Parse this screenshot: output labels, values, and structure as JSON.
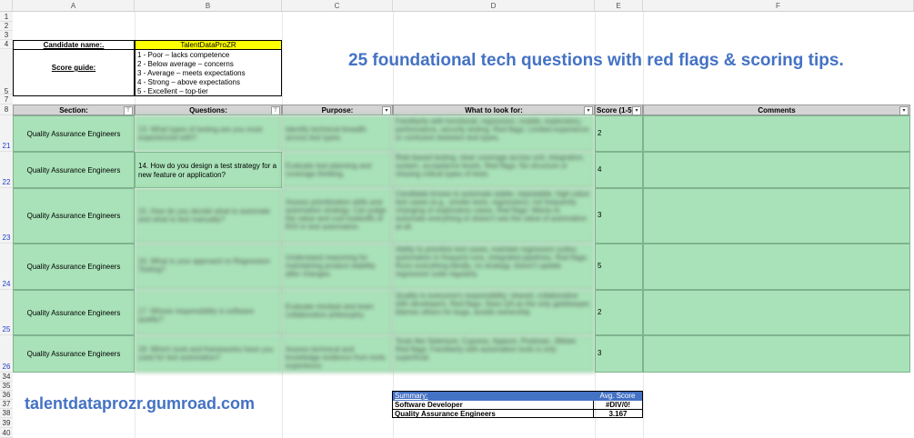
{
  "columns": [
    "A",
    "B",
    "C",
    "D",
    "E",
    "F"
  ],
  "row_numbers": {
    "top": [
      "1",
      "2",
      "3",
      "4",
      "5",
      "7",
      "8"
    ],
    "data": [
      "21",
      "22",
      "23",
      "24",
      "25",
      "26"
    ],
    "bottom": [
      "34",
      "35",
      "36",
      "37",
      "38",
      "39",
      "40"
    ]
  },
  "candidate": {
    "label": "Candidate name:.",
    "value": "TalentDataProZR"
  },
  "score_guide": {
    "label": "Score guide:",
    "items": [
      "1 - Poor – lacks competence",
      "2 - Below average – concerns",
      "3 - Average – meets expectations",
      "4 - Strong – above expectations",
      "5 - Excellent – top-tier"
    ]
  },
  "headline": "25 foundational tech questions with red flags & scoring tips.",
  "table_headers": {
    "section": "Section:",
    "questions": "Questions:",
    "purpose": "Purpose:",
    "what": "What to look for:",
    "score": "Score (1-5):",
    "comments": "Comments"
  },
  "rows": [
    {
      "section": "Quality Assurance Engineers",
      "question": "13. What types of testing are you most experienced with?",
      "purpose": "Identify technical breadth across test types.",
      "what": "Familiarity with functional, regression, mobile, exploratory, performance, security testing. Red flags: Limited experience or confusion between test types.",
      "score": "2"
    },
    {
      "section": "Quality Assurance Engineers",
      "question": "14. How do you design a test strategy for a new feature or application?",
      "purpose": "Evaluate test planning and coverage thinking.",
      "what": "Risk-based testing, clear coverage across unit, integration, system, acceptance levels. Red flags: No structure or missing critical types of tests.",
      "score": "4"
    },
    {
      "section": "Quality Assurance Engineers",
      "question": "15. How do you decide what to automate and what to test manually?",
      "purpose": "Assess prioritization skills and automation strategy. Can judge the value and cost tradeoffs of ROI in test automation.",
      "what": "Candidate knows to automate stable, repeatable, high-value test cases (e.g., smoke tests, regression); not frequently changing or exploratory cases. Red flags: Wants to automate everything or doesn't see the value of automation at all.",
      "score": "3"
    },
    {
      "section": "Quality Assurance Engineers",
      "question": "16. What is your approach to Regression Testing?",
      "purpose": "Understand reasoning for maintaining product stability after changes.",
      "what": "Ability to prioritize test cases, maintain regression suites, automation in frequent runs, integrated pipelines. Red flags: Runs everything blindly, no strategy, doesn't update regression suite regularly.",
      "score": "5"
    },
    {
      "section": "Quality Assurance Engineers",
      "question": "17. Whose responsibility is software quality?",
      "purpose": "Evaluate mindset and team collaboration philosophy.",
      "what": "Quality is everyone's responsibility: shared, collaborative with developers. Red flags: Sees QA as the only gatekeeper, blames others for bugs, avoids ownership.",
      "score": "2"
    },
    {
      "section": "Quality Assurance Engineers",
      "question": "18. Which tools and frameworks have you used for test automation?",
      "purpose": "Assess technical and knowledge evidence from tools experience.",
      "what": "Tools like Selenium, Cypress, Appium, Postman, JMeter. Red flags: Familiarity with automation tools is only superficial.",
      "score": "3"
    }
  ],
  "summary": {
    "header": "Summary:",
    "avg_header": "Avg. Score",
    "items": [
      {
        "name": "Software Developer",
        "score": "#DIV/0!"
      },
      {
        "name": "Quality Assurance Engineers",
        "score": "3.167"
      }
    ]
  },
  "footer_link": "talentdataprozr.gumroad.com",
  "colors": {
    "accent_blue": "#4472c4",
    "row_green": "#a9e2b8",
    "summary_header": "#4472c4",
    "candidate_yellow": "#ffff00",
    "row_number_blue": "#1e3ccd"
  }
}
